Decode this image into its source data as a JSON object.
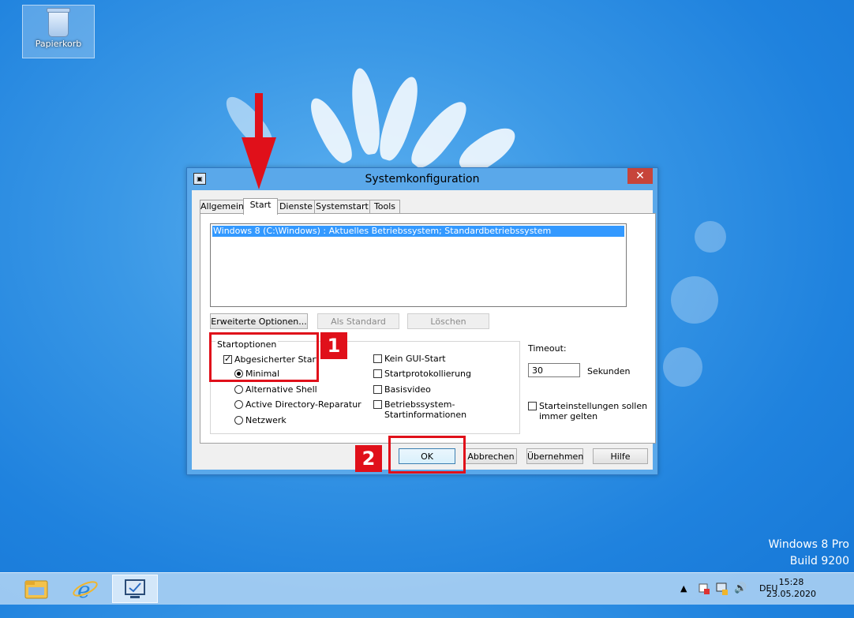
{
  "desktop": {
    "recycle_bin_label": "Papierkorb",
    "branding_line1": "Windows 8 Pro",
    "branding_line2": "Build 9200"
  },
  "dialog": {
    "title": "Systemkonfiguration",
    "close_glyph": "✕",
    "tabs": [
      {
        "label": "Allgemein"
      },
      {
        "label": "Start"
      },
      {
        "label": "Dienste"
      },
      {
        "label": "Systemstart"
      },
      {
        "label": "Tools"
      }
    ],
    "active_tab": "Start",
    "os_list": [
      "Windows 8 (C:\\Windows) : Aktuelles Betriebssystem; Standardbetriebssystem"
    ],
    "buttons": {
      "advanced": "Erweiterte Optionen...",
      "set_default": "Als Standard",
      "delete": "Löschen"
    },
    "boot_options": {
      "group_label": "Startoptionen",
      "safe_boot": {
        "label": "Abgesicherter Start",
        "checked": true
      },
      "minimal": {
        "label": "Minimal",
        "checked": true
      },
      "alternate_shell": {
        "label": "Alternative Shell"
      },
      "ad_repair": {
        "label": "Active Directory-Reparatur"
      },
      "network": {
        "label": "Netzwerk"
      },
      "no_gui": {
        "label": "Kein GUI-Start"
      },
      "boot_log": {
        "label": "Startprotokollierung"
      },
      "base_video": {
        "label": "Basisvideo"
      },
      "os_boot_info_line1": "Betriebssystem-",
      "os_boot_info_line2": "Startinformationen"
    },
    "timeout": {
      "label": "Timeout:",
      "value": "30",
      "unit": "Sekunden"
    },
    "permanent_line1": "Starteinstellungen sollen",
    "permanent_line2": "immer gelten",
    "footer": {
      "ok": "OK",
      "cancel": "Abbrechen",
      "apply": "Übernehmen",
      "help": "Hilfe"
    }
  },
  "annotations": {
    "badge1": "1",
    "badge2": "2",
    "color": "#e0101a"
  },
  "taskbar": {
    "items": [
      {
        "icon": "file-explorer-icon"
      },
      {
        "icon": "internet-explorer-icon"
      },
      {
        "icon": "system-configuration-icon",
        "active": true
      }
    ],
    "tray": {
      "language": "DEU",
      "time": "15:28",
      "date": "23.05.2020"
    }
  }
}
